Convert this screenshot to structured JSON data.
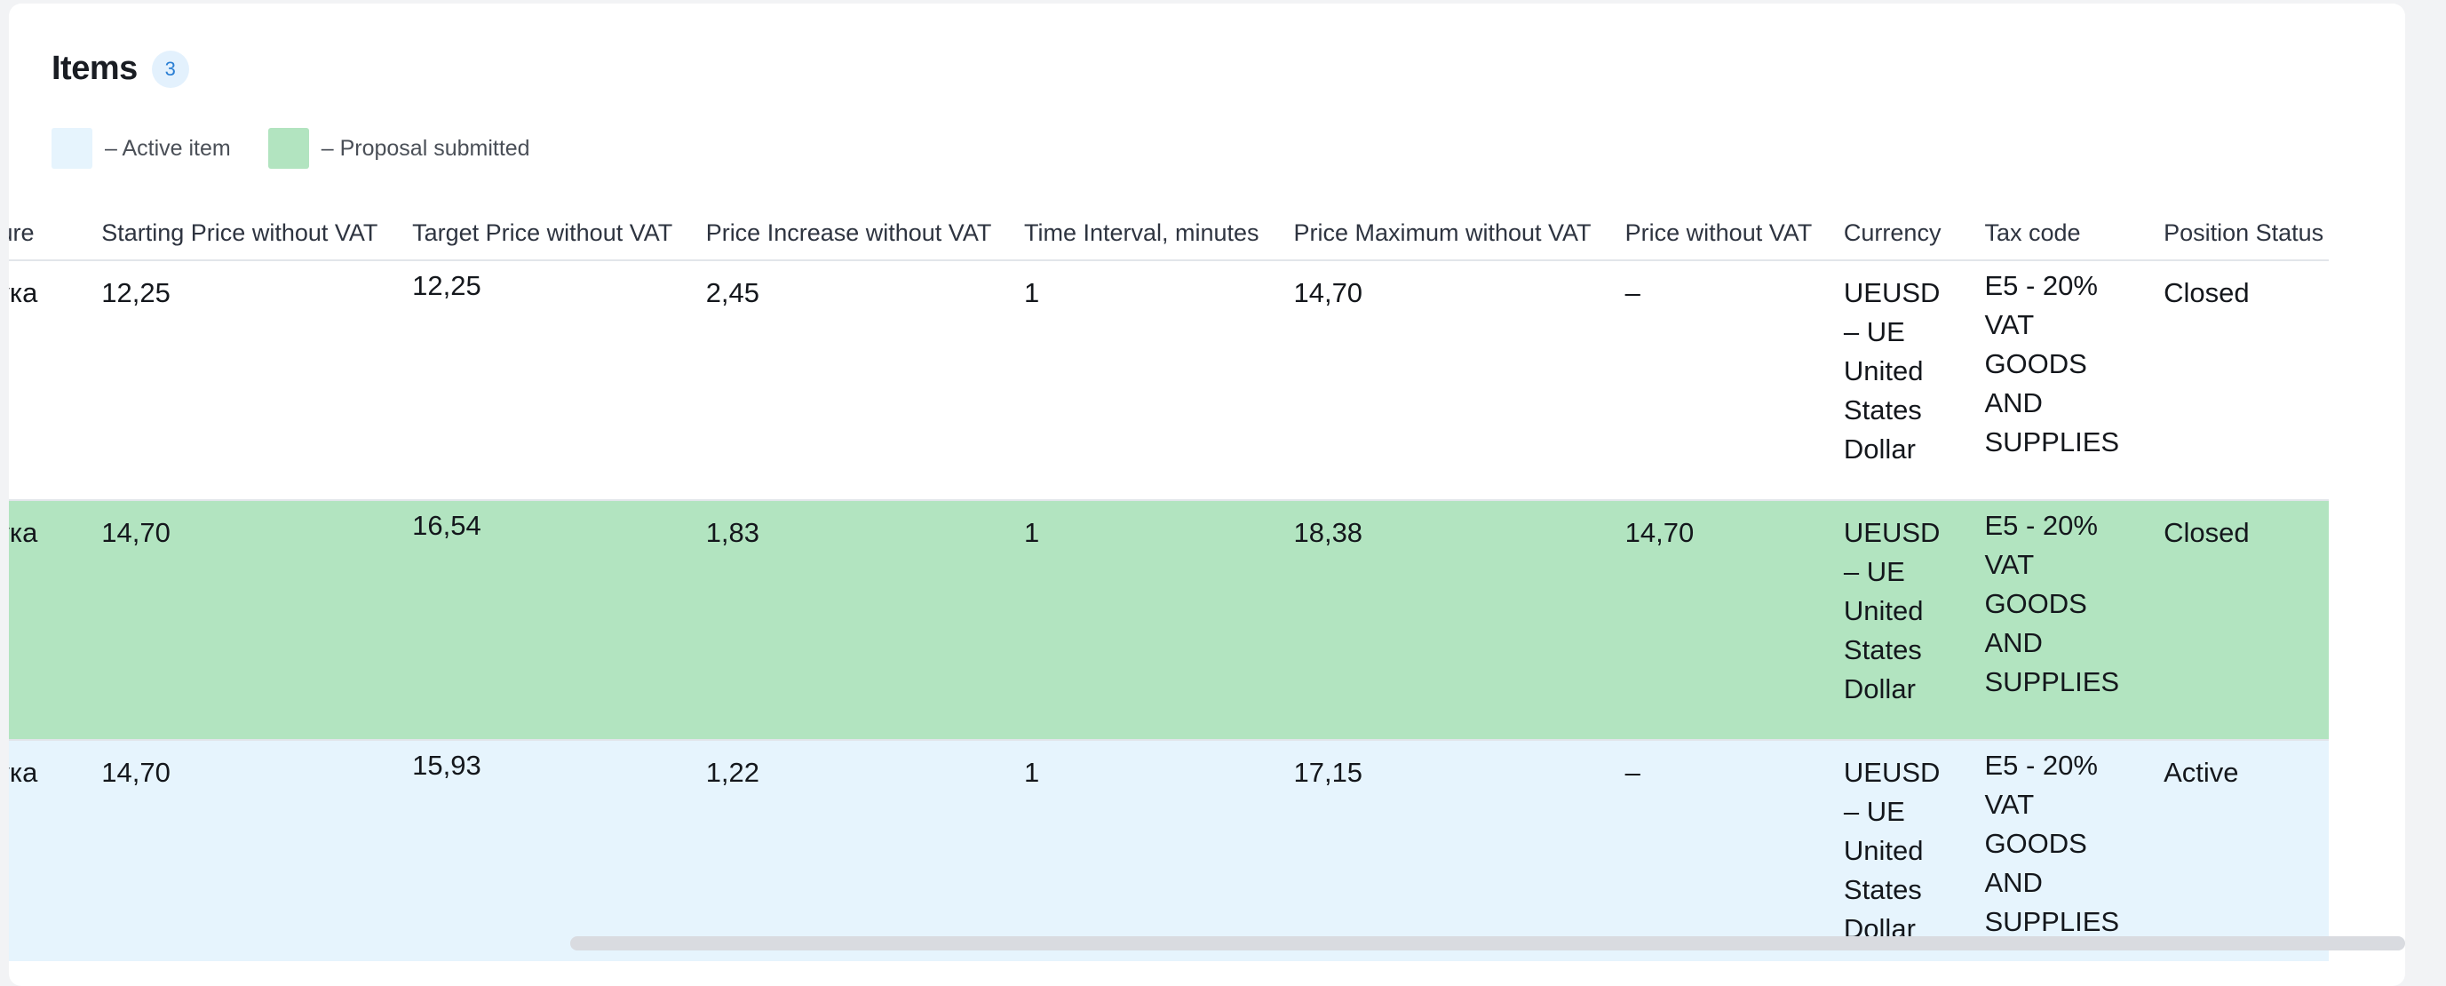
{
  "items": {
    "title": "Items",
    "count": "3"
  },
  "legend": [
    {
      "label": "– Active item",
      "color": "#e6f4fd"
    },
    {
      "label": "– Proposal submitted",
      "color": "#b2e4c0"
    }
  ],
  "table": {
    "columns": [
      "easure",
      "Starting Price without VAT",
      "Target Price without VAT",
      "Price Increase without VAT",
      "Time Interval, minutes",
      "Price Maximum without VAT",
      "Price without VAT",
      "Currency",
      "Tax code",
      "Position Status"
    ],
    "rows": [
      {
        "state": "normal",
        "unit": "штука",
        "starting_price": "12,25",
        "target_price": "12,25",
        "price_increase": "2,45",
        "time_interval": "1",
        "price_maximum": "14,70",
        "price": "–",
        "currency": "UEUSD – UE United States Dollar",
        "tax_code": "E5 - 20% VAT GOODS AND SUPPLIES",
        "status": "Closed"
      },
      {
        "state": "proposal-submitted",
        "unit": "штука",
        "starting_price": "14,70",
        "target_price": "16,54",
        "price_increase": "1,83",
        "time_interval": "1",
        "price_maximum": "18,38",
        "price": "14,70",
        "currency": "UEUSD – UE United States Dollar",
        "tax_code": "E5 - 20% VAT GOODS AND SUPPLIES",
        "status": "Closed"
      },
      {
        "state": "active",
        "unit": "штука",
        "starting_price": "14,70",
        "target_price": "15,93",
        "price_increase": "1,22",
        "time_interval": "1",
        "price_maximum": "17,15",
        "price": "–",
        "currency": "UEUSD – UE United States Dollar",
        "tax_code": "E5 - 20% VAT GOODS AND SUPPLIES",
        "status": "Active"
      }
    ]
  }
}
